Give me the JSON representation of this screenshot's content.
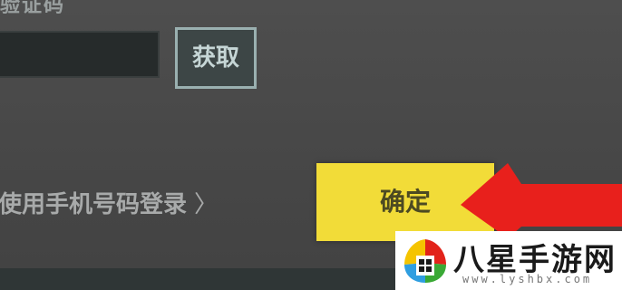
{
  "form": {
    "code_label": "验证码",
    "code_value": "",
    "get_button_label": "获取",
    "phone_login_label": "使用手机号码登录",
    "phone_login_chevron": "〉",
    "confirm_button_label": "确定"
  },
  "annotation": {
    "arrow_color": "#e8201c"
  },
  "watermark": {
    "title": "八星手游网",
    "url": "www.lyshbx.com"
  },
  "colors": {
    "confirm_bg": "#f2dc38",
    "get_button_border": "#9ab0b0",
    "dialog_bg": "#4a4a4a"
  }
}
